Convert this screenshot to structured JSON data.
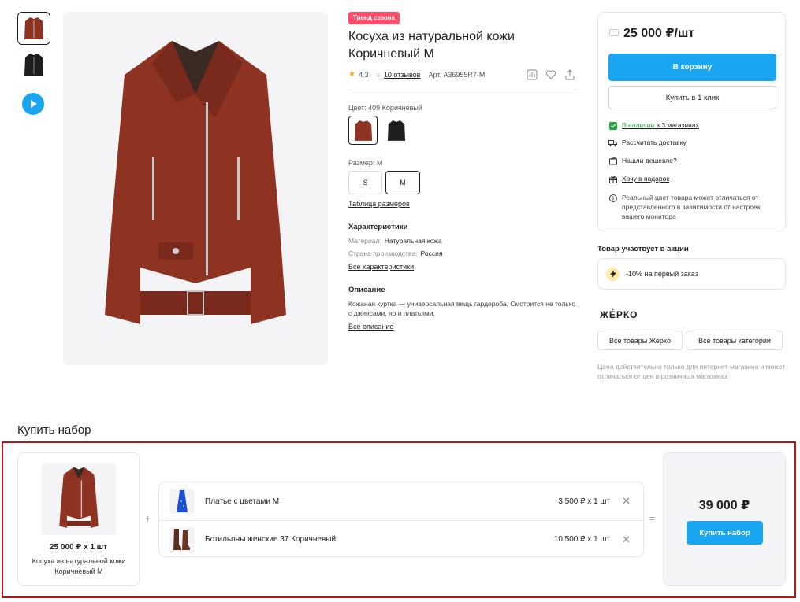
{
  "gallery": {
    "thumbnails": [
      "brown-jacket",
      "black-jacket"
    ],
    "video_icon": "play-icon"
  },
  "product": {
    "badge": "Тренд сезона",
    "title": "Косуха из натуральной кожи Коричневый M",
    "rating": "4.3",
    "reviews": "10 отзывов",
    "article": "Арт. A36955R7-M",
    "color_label": "Цвет: 409 Коричневый",
    "size_label": "Размер: M",
    "sizes": [
      "S",
      "M"
    ],
    "selected_size": "M",
    "size_table_link": "Таблица размеров",
    "specs_title": "Характеристики",
    "specs": [
      {
        "name": "Материал:",
        "value": "Натуральная кожа"
      },
      {
        "name": "Страна производства:",
        "value": "Россия"
      }
    ],
    "all_specs_link": "Все характеристики",
    "description_title": "Описание",
    "description": "Кожаная куртка — универсальная вещь гардероба. Смотрится не только с джинсами, но и платьями.",
    "all_description_link": "Все описание"
  },
  "buy": {
    "price": "25 000 ₽/шт",
    "cart_button": "В корзину",
    "one_click_button": "Купить в 1 клик",
    "availability_green": "В наличии",
    "availability_rest": " в 3 магазинах",
    "delivery": "Рассчитать доставку",
    "cheaper": "Нашли дешевле?",
    "gift": "Хочу в подарок",
    "color_note": "Реальный цвет товара может отличаться от представленного в зависимости от настроек вашего монитора"
  },
  "promo": {
    "title": "Товар участвует в акции",
    "text": "-10% на первый заказ"
  },
  "brand": {
    "name": "ЖЕ́РКО",
    "all_brand": "Все товары Жерко",
    "all_category": "Все товары категории",
    "note": "Цена действительна только для интернет-магазина и может отличаться от цен в розничных магазинах"
  },
  "bundle": {
    "title": "Купить набор",
    "main": {
      "price": "25 000 ₽ x 1 шт",
      "name": "Косуха из натуральной кожи Коричневый M"
    },
    "items": [
      {
        "name": "Платье с цветами M",
        "price": "3 500 ₽ x 1 шт"
      },
      {
        "name": "Ботильоны женские 37 Коричневый",
        "price": "10 500 ₽ x 1 шт"
      }
    ],
    "plus": "+",
    "equals": "=",
    "total": "39 000 ₽",
    "buy_button": "Купить набор"
  },
  "colors": {
    "accent": "#1aa5f0",
    "badge": "#ff4d6a",
    "in_stock": "#21a63c",
    "frame": "#b31616",
    "jacket": "#8e3221"
  }
}
